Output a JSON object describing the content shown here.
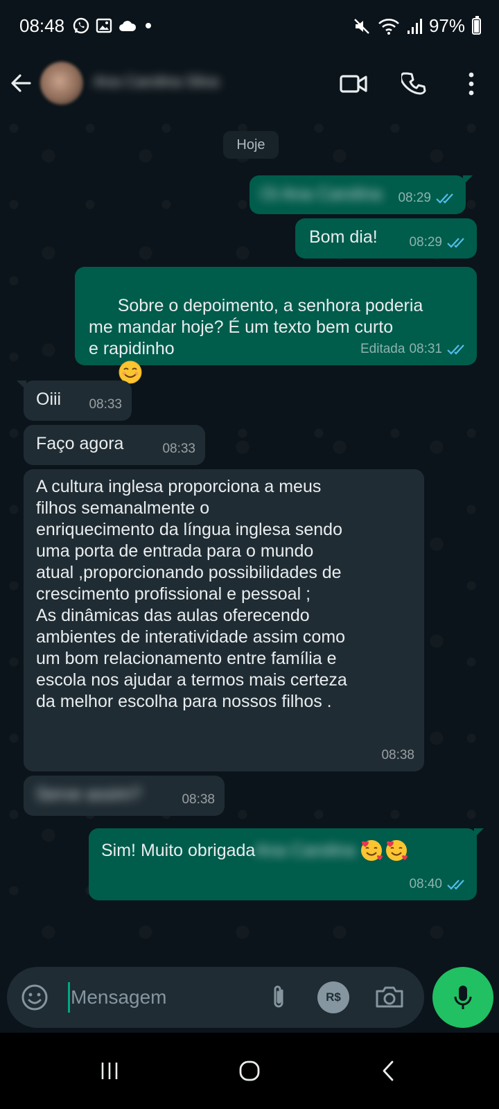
{
  "status_bar": {
    "time": "08:48",
    "battery": "97%",
    "icons": [
      "whatsapp-icon",
      "gallery-icon",
      "cloud-icon",
      "dot-icon",
      "mute-icon",
      "wifi-icon",
      "signal-icon",
      "battery-icon"
    ]
  },
  "header": {
    "contact_name": "Ana Carolina Silva",
    "actions": [
      "video-call-icon",
      "voice-call-icon",
      "more-options-icon"
    ]
  },
  "chat": {
    "date_chip": "Hoje",
    "messages": [
      {
        "direction": "out",
        "text": "Oi Ana Carolina",
        "redacted": true,
        "time": "08:29",
        "status": "read"
      },
      {
        "direction": "out",
        "text": "Bom dia!",
        "time": "08:29",
        "status": "read"
      },
      {
        "direction": "out",
        "text": "Sobre o depoimento, a senhora poderia\nme mandar hoje? É um texto bem curto\ne rapidinho",
        "emoji": "smiling-face",
        "edited_label": "Editada",
        "time": "08:31",
        "status": "read"
      },
      {
        "direction": "in",
        "text": "Oiii",
        "time": "08:33"
      },
      {
        "direction": "in",
        "text": "Faço agora",
        "time": "08:33"
      },
      {
        "direction": "in",
        "text": "A cultura inglesa proporciona a meus\nfilhos semanalmente o\nenriquecimento da língua inglesa sendo\numa porta de entrada para o mundo\natual ,proporcionando possibilidades de\ncrescimento profissional e pessoal ;\nAs dinâmicas das aulas oferecendo\nambientes de interatividade assim como\num bom relacionamento entre família e\nescola nos ajudar a termos mais certeza\nda melhor escolha para nossos filhos .",
        "time": "08:38"
      },
      {
        "direction": "in",
        "text": "Serve assim?",
        "redacted": true,
        "time": "08:38"
      },
      {
        "direction": "out",
        "text": "Sim! Muito obrigada",
        "redacted_suffix": "Ana Carolina",
        "emoji": "smiling-face-with-hearts",
        "time": "08:40",
        "status": "read"
      }
    ]
  },
  "composer": {
    "placeholder": "Mensagem",
    "pay_label": "R$",
    "icons": [
      "emoji-icon",
      "attach-icon",
      "payment-icon",
      "camera-icon",
      "mic-icon"
    ]
  },
  "colors": {
    "background": "#0b141a",
    "outgoing_bubble": "#005c4b",
    "incoming_bubble": "#202c33",
    "read_ticks": "#53bdeb",
    "accent": "#21c063"
  }
}
